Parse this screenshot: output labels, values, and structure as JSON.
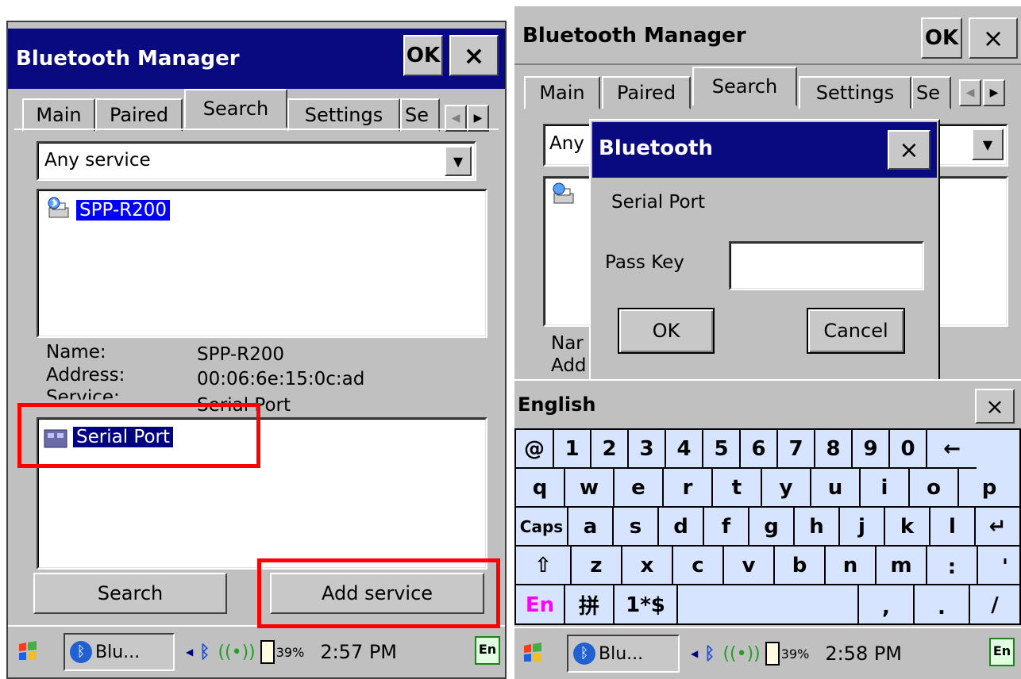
{
  "left": {
    "title": "Bluetooth Manager",
    "ok_label": "OK",
    "close_label": "×",
    "tabs": [
      "Main",
      "Paired",
      "Search",
      "Settings",
      "Se"
    ],
    "service_dropdown": "Any service",
    "device_name": "SPP-R200",
    "info": {
      "name_label": "Name:",
      "name_value": "SPP-R200",
      "address_label": "Address:",
      "address_value": "00:06:6e:15:0c:ad",
      "service_label": "Service:",
      "service_value": "Serial Port"
    },
    "service_item": "Serial Port",
    "search_button": "Search",
    "add_service_button": "Add service",
    "taskbar": {
      "app": "Blu...",
      "battery": "39%",
      "time": "2:57 PM",
      "ime": "En"
    }
  },
  "right": {
    "title": "Bluetooth Manager",
    "ok_label": "OK",
    "close_label": "×",
    "tabs": [
      "Main",
      "Paired",
      "Search",
      "Settings",
      "Se"
    ],
    "dropdown_partial": "Any",
    "name_partial": "Nar",
    "address_partial": "Add",
    "dialog": {
      "title": "Bluetooth",
      "close_label": "×",
      "service": "Serial Port",
      "pass_key_label": "Pass Key",
      "pass_key_value": "",
      "ok_button": "OK",
      "cancel_button": "Cancel"
    },
    "keyboard": {
      "title": "English",
      "close_label": "×",
      "rows": [
        [
          "@",
          "1",
          "2",
          "3",
          "4",
          "5",
          "6",
          "7",
          "8",
          "9",
          "0",
          "←"
        ],
        [
          "q",
          "w",
          "e",
          "r",
          "t",
          "y",
          "u",
          "i",
          "o",
          "p"
        ],
        [
          "Caps",
          "a",
          "s",
          "d",
          "f",
          "g",
          "h",
          "j",
          "k",
          "l",
          "↵"
        ],
        [
          "⇧",
          "z",
          "x",
          "c",
          "v",
          "b",
          "n",
          "m",
          ":",
          "'"
        ],
        [
          "En",
          "拼",
          "1*$",
          "",
          ",",
          ".",
          "/"
        ]
      ]
    },
    "taskbar": {
      "app": "Blu...",
      "battery": "39%",
      "time": "2:58 PM",
      "ime": "En"
    }
  },
  "colors": {
    "titlebar": "#0a0a80",
    "highlight": "#0000ff",
    "keyboard": "#d6e4ff",
    "annotation": "#ff0000",
    "en_key": "#ff00ff"
  }
}
